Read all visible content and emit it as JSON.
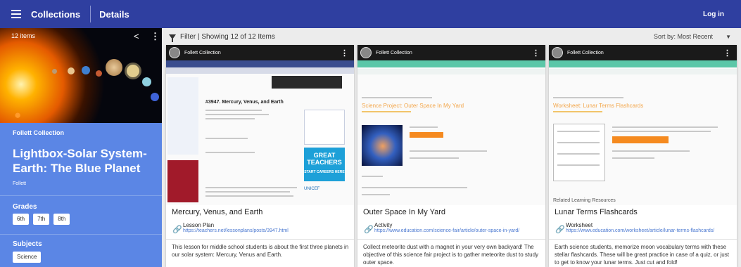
{
  "topbar": {
    "collections_label": "Collections",
    "details_label": "Details",
    "login_label": "Log in"
  },
  "sidebar": {
    "count": "12 items",
    "publisher": "Follett Collection",
    "title": "Lightbox-Solar System-Earth: The Blue Planet",
    "author": "Follett",
    "grades_heading": "Grades",
    "grades": [
      "6th",
      "7th",
      "8th"
    ],
    "subjects_heading": "Subjects",
    "subjects": [
      "Science"
    ]
  },
  "filterbar": {
    "filter_text": "Filter | Showing 12 of 12 Items",
    "sort_label": "Sort by:  Most Recent"
  },
  "cards": [
    {
      "header": "Follett Collection",
      "title": "Mercury, Venus, and Earth",
      "type": "Lesson Plan",
      "url": "https://teachers.net/lessonplans/posts/3947.html",
      "description": "This lesson for middle school students is about the first three planets in our solar system: Mercury, Venus and Earth.",
      "shot": {
        "heading": "#3947. Mercury, Venus, and Earth",
        "ad1": "GREAT TEACHERS",
        "ad2": "START CAREERS HERE",
        "unicef": "UNICEF"
      }
    },
    {
      "header": "Follett Collection",
      "title": "Outer Space In My Yard",
      "type": "Activity",
      "url": "https://www.education.com/science-fair/article/outer-space-in-yard/",
      "description": "Collect meteorite dust with a magnet in your very own backyard! The objective of this science fair project is to gather meteorite dust to study outer space.",
      "shot": {
        "heading": "Science Project: Outer Space In My Yard"
      }
    },
    {
      "header": "Follett Collection",
      "title": "Lunar Terms Flashcards",
      "type": "Worksheet",
      "url": "https://www.education.com/worksheet/article/lunar-terms-flashcards/",
      "description": "Earth science students, memorize moon vocabulary terms with these stellar flashcards. These will be great practice in case of a quiz, or just to get to know your lunar terms. Just cut and fold!",
      "shot": {
        "heading": "Worksheet: Lunar Terms Flashcards",
        "related": "Related Learning Resources"
      }
    }
  ],
  "colors": {
    "topbar": "#2f3fa0",
    "sidebar": "#5b86e5",
    "link": "#4a78d0",
    "accent": "#f58a1f"
  }
}
